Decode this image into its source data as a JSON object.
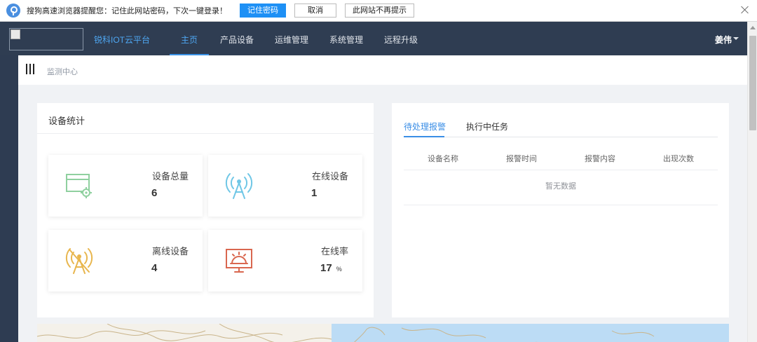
{
  "password_bar": {
    "message": "搜狗高速浏览器提醒您：记住此网站密码，下次一键登录！",
    "remember_label": "记住密码",
    "cancel_label": "取消",
    "never_label": "此网站不再提示"
  },
  "topnav": {
    "brand": "锐科IOT云平台",
    "items": [
      {
        "label": "主页"
      },
      {
        "label": "产品设备"
      },
      {
        "label": "运维管理"
      },
      {
        "label": "系统管理"
      },
      {
        "label": "远程升级"
      }
    ],
    "user": "姜伟"
  },
  "breadcrumb": {
    "current": "监测中心"
  },
  "device_stats": {
    "title": "设备统计",
    "cards": [
      {
        "label": "设备总量",
        "value": "6",
        "icon": "device-settings-icon",
        "color": "#8fd09f"
      },
      {
        "label": "在线设备",
        "value": "1",
        "icon": "signal-tower-icon",
        "color": "#70c7e6"
      },
      {
        "label": "离线设备",
        "value": "4",
        "icon": "signal-tower-off-icon",
        "color": "#e8b64e"
      },
      {
        "label": "在线率",
        "value": "17",
        "unit": "%",
        "icon": "monitor-alert-icon",
        "color": "#d9674f"
      }
    ]
  },
  "alarm_panel": {
    "tabs": [
      {
        "label": "待处理报警"
      },
      {
        "label": "执行中任务"
      }
    ],
    "columns": [
      "设备名称",
      "报警时间",
      "报警内容",
      "出现次数"
    ],
    "empty_text": "暂无数据"
  },
  "colors": {
    "nav_bg": "#2f3d52",
    "accent": "#3a8ee6",
    "page_bg": "#f0f2f5"
  }
}
